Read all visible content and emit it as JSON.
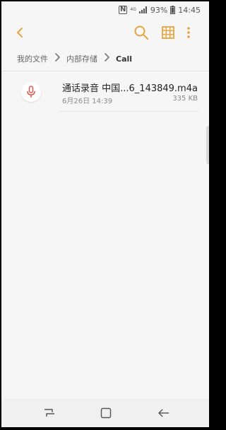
{
  "status_bar": {
    "nfc": "N",
    "network": "4G",
    "battery": "93%",
    "time": "14:45"
  },
  "header": {
    "back_icon": "chevron-left-icon",
    "search_icon": "search-icon",
    "grid_icon": "grid-view-icon",
    "more_icon": "more-vertical-icon",
    "accent_color": "#e8a33c"
  },
  "breadcrumb": {
    "items": [
      "我的文件",
      "内部存储",
      "Call"
    ]
  },
  "files": [
    {
      "icon": "microphone-icon",
      "icon_color": "#e0574a",
      "name": "通话录音 中国...6_143849.m4a",
      "date": "6月26日 14:39",
      "size": "335 KB"
    }
  ],
  "nav_bar": {
    "recent_icon": "recent-apps-icon",
    "home_icon": "home-icon",
    "back_icon": "back-arrow-icon"
  }
}
